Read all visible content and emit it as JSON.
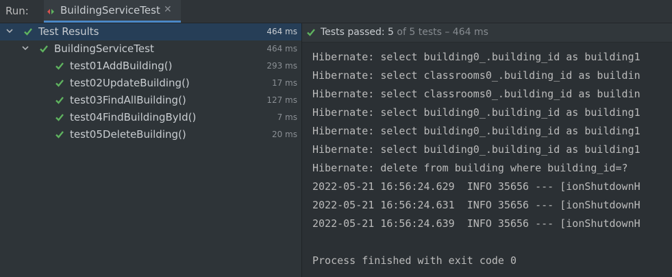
{
  "run_label": "Run:",
  "tab": {
    "title": "BuildingServiceTest",
    "close_glyph": "✕",
    "icon": "test-run-icon"
  },
  "tree": {
    "root": {
      "label": "Test Results",
      "time": "464 ms"
    },
    "suite": {
      "label": "BuildingServiceTest",
      "time": "464 ms"
    },
    "tests": [
      {
        "label": "test01AddBuilding()",
        "time": "293 ms"
      },
      {
        "label": "test02UpdateBuilding()",
        "time": "17 ms"
      },
      {
        "label": "test03FindAllBuilding()",
        "time": "127 ms"
      },
      {
        "label": "test04FindBuildingById()",
        "time": "7 ms"
      },
      {
        "label": "test05DeleteBuilding()",
        "time": "20 ms"
      }
    ]
  },
  "status": {
    "prefix": "Tests passed:",
    "count": "5",
    "suffix": "of 5 tests – 464 ms"
  },
  "console": [
    "Hibernate: select building0_.building_id as building1",
    "Hibernate: select classrooms0_.building_id as buildin",
    "Hibernate: select classrooms0_.building_id as buildin",
    "Hibernate: select building0_.building_id as building1",
    "Hibernate: select building0_.building_id as building1",
    "Hibernate: select building0_.building_id as building1",
    "Hibernate: delete from building where building_id=?",
    "2022-05-21 16:56:24.629  INFO 35656 --- [ionShutdownH",
    "2022-05-21 16:56:24.631  INFO 35656 --- [ionShutdownH",
    "2022-05-21 16:56:24.639  INFO 35656 --- [ionShutdownH",
    "",
    "Process finished with exit code 0"
  ],
  "colors": {
    "pass_green": "#5fb35f",
    "selection": "#263e57",
    "accent": "#4a88c7"
  }
}
